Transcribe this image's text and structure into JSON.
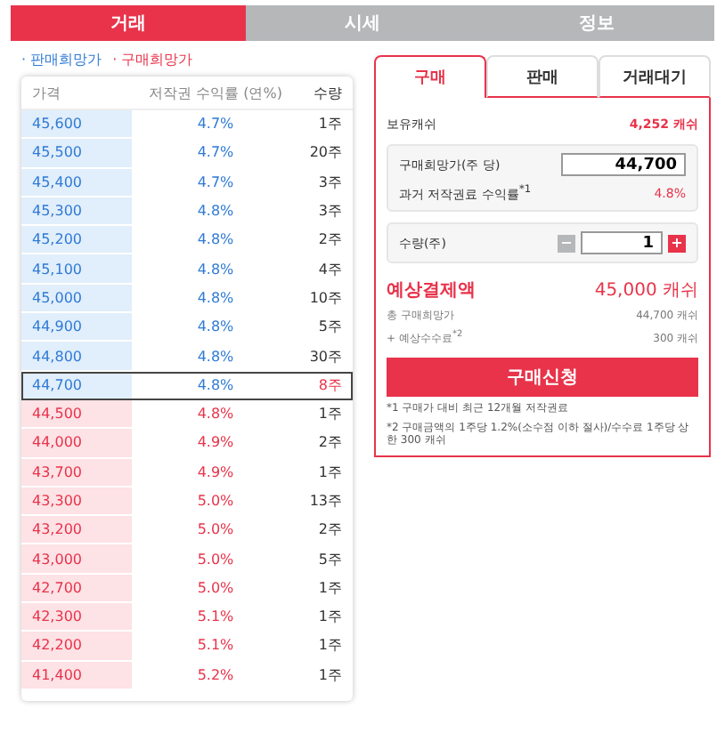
{
  "top_tabs": [
    {
      "label": "거래",
      "selected": true
    },
    {
      "label": "시세",
      "selected": false
    },
    {
      "label": "정보",
      "selected": false
    }
  ],
  "legend": [
    {
      "kind": "sell",
      "label": "· 판매희망가"
    },
    {
      "kind": "buy",
      "label": "· 구매희망가"
    }
  ],
  "order_book": {
    "columns": [
      "가격",
      "저작권 수익률 (연%)",
      "수량"
    ],
    "rows": [
      {
        "kind": "sell",
        "price": "45,600",
        "yield": "4.7%",
        "qty": "1주",
        "selected": false
      },
      {
        "kind": "sell",
        "price": "45,500",
        "yield": "4.7%",
        "qty": "20주",
        "selected": false
      },
      {
        "kind": "sell",
        "price": "45,400",
        "yield": "4.7%",
        "qty": "3주",
        "selected": false
      },
      {
        "kind": "sell",
        "price": "45,300",
        "yield": "4.8%",
        "qty": "3주",
        "selected": false
      },
      {
        "kind": "sell",
        "price": "45,200",
        "yield": "4.8%",
        "qty": "2주",
        "selected": false
      },
      {
        "kind": "sell",
        "price": "45,100",
        "yield": "4.8%",
        "qty": "4주",
        "selected": false
      },
      {
        "kind": "sell",
        "price": "45,000",
        "yield": "4.8%",
        "qty": "10주",
        "selected": false
      },
      {
        "kind": "sell",
        "price": "44,900",
        "yield": "4.8%",
        "qty": "5주",
        "selected": false
      },
      {
        "kind": "sell",
        "price": "44,800",
        "yield": "4.8%",
        "qty": "30주",
        "selected": false
      },
      {
        "kind": "sell",
        "price": "44,700",
        "yield": "4.8%",
        "qty": "8주",
        "selected": true
      },
      {
        "kind": "buy",
        "price": "44,500",
        "yield": "4.8%",
        "qty": "1주",
        "selected": false
      },
      {
        "kind": "buy",
        "price": "44,000",
        "yield": "4.9%",
        "qty": "2주",
        "selected": false
      },
      {
        "kind": "buy",
        "price": "43,700",
        "yield": "4.9%",
        "qty": "1주",
        "selected": false
      },
      {
        "kind": "buy",
        "price": "43,300",
        "yield": "5.0%",
        "qty": "13주",
        "selected": false
      },
      {
        "kind": "buy",
        "price": "43,200",
        "yield": "5.0%",
        "qty": "2주",
        "selected": false
      },
      {
        "kind": "buy",
        "price": "43,000",
        "yield": "5.0%",
        "qty": "5주",
        "selected": false
      },
      {
        "kind": "buy",
        "price": "42,700",
        "yield": "5.0%",
        "qty": "1주",
        "selected": false
      },
      {
        "kind": "buy",
        "price": "42,300",
        "yield": "5.1%",
        "qty": "1주",
        "selected": false
      },
      {
        "kind": "buy",
        "price": "42,200",
        "yield": "5.1%",
        "qty": "1주",
        "selected": false
      },
      {
        "kind": "buy",
        "price": "41,400",
        "yield": "5.2%",
        "qty": "1주",
        "selected": false
      }
    ]
  },
  "order_panel": {
    "tabs": [
      {
        "label": "구매",
        "selected": true
      },
      {
        "label": "판매",
        "selected": false
      },
      {
        "label": "거래대기",
        "selected": false
      }
    ],
    "balance": {
      "label": "보유캐쉬",
      "value": "4,252 캐쉬"
    },
    "price_field": {
      "label": "구매희망가(주 당)",
      "value": "44,700"
    },
    "past_yield": {
      "label": "과거 저작권료 수익률$^{*1}$",
      "value": "4.8%"
    },
    "quantity_field": {
      "label": "수량(주)",
      "value": "1",
      "minus": "−",
      "plus": "+"
    },
    "total": {
      "label": "예상결제액",
      "value": "45,000 캐쉬"
    },
    "breakdown": [
      {
        "label": "총 구매희망가",
        "value": "44,700 캐쉬"
      },
      {
        "label": "+ 예상수수료$^{*2}$",
        "value": "300 캐쉬"
      }
    ],
    "submit": "구매신청",
    "footnotes": [
      "*1 구매가 대비 최근 12개월 저작권료",
      "*2 구매금액의 1주당 1.2%(소수점 이하 절사)/수수료 1주당 상한 300 캐쉬"
    ]
  }
}
